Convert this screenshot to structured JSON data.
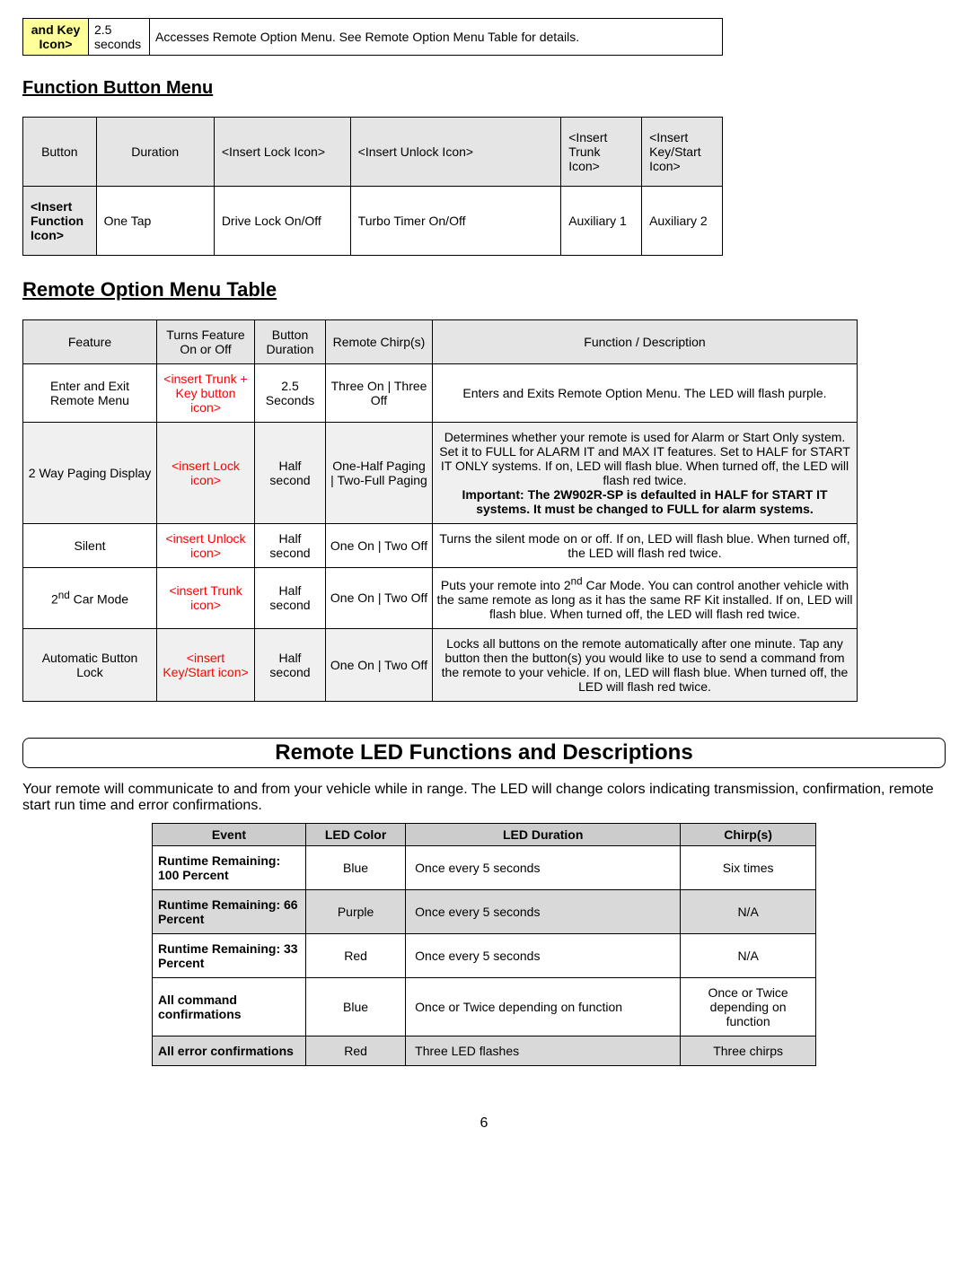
{
  "top_row": {
    "icon_label": "and Key Icon>",
    "duration": "2.5 seconds",
    "desc": "Accesses Remote Option Menu. See Remote Option Menu Table for details."
  },
  "section1_title": "Function Button Menu",
  "fbm": {
    "headers": [
      "Button",
      "Duration",
      "<Insert Lock Icon>",
      "<Insert Unlock Icon>",
      "<Insert Trunk Icon>",
      "<Insert Key/Start Icon>"
    ],
    "row": [
      "<Insert Function Icon>",
      "One Tap",
      "Drive Lock On/Off",
      "Turbo Timer On/Off",
      "Auxiliary 1",
      "Auxiliary 2"
    ]
  },
  "section2_title": "Remote Option Menu Table",
  "rom": {
    "headers": [
      "Feature",
      "Turns Feature On or Off",
      "Button Duration",
      "Remote Chirp(s)",
      "Function / Description"
    ],
    "rows": [
      {
        "feature": "Enter and Exit Remote Menu",
        "icon": "<insert Trunk + Key button icon>",
        "duration": "2.5 Seconds",
        "chirps": "Three On | Three Off",
        "desc1": "Enters and Exits Remote Option Menu. The LED will flash purple.",
        "desc_bold": ""
      },
      {
        "feature": "2 Way Paging Display",
        "icon": "<insert Lock icon>",
        "duration": "Half second",
        "chirps": "One-Half Paging | Two-Full Paging",
        "desc1": "Determines whether your remote is used for Alarm or Start Only system. Set it to FULL for ALARM IT and MAX IT features. Set to HALF for START IT ONLY systems. If on, LED will flash blue. When turned off, the LED will flash red twice.",
        "desc_bold": "Important: The 2W902R-SP is defaulted in HALF for START IT systems. It must be changed to FULL for alarm systems."
      },
      {
        "feature": "Silent",
        "icon": "<insert Unlock icon>",
        "duration": "Half second",
        "chirps": "One On | Two Off",
        "desc1": "Turns the silent mode on or off. If on, LED will flash blue. When turned off, the LED will flash red twice.",
        "desc_bold": ""
      },
      {
        "feature_html": "2<sup>nd</sup> Car Mode",
        "feature": "2nd Car Mode",
        "icon": "<insert Trunk icon>",
        "duration": "Half second",
        "chirps": "One On | Two Off",
        "desc1_html": "Puts your remote into 2<sup>nd</sup> Car Mode. You can control another vehicle with the same remote as long as it has the same RF Kit installed. If on, LED will flash blue. When turned off, the LED will flash red twice.",
        "desc1": "Puts your remote into 2nd Car Mode. You can control another vehicle with the same remote as long as it has the same RF Kit installed. If on, LED will flash blue. When turned off, the LED will flash red twice.",
        "desc_bold": ""
      },
      {
        "feature": "Automatic Button Lock",
        "icon": "<insert Key/Start icon>",
        "duration": "Half second",
        "chirps": "One On | Two Off",
        "desc1": "Locks all buttons on the remote automatically after one minute. Tap any button then the button(s) you would like to use to send a command from the remote to your vehicle. If on, LED will flash blue. When turned off, the LED will flash red twice.",
        "desc_bold": ""
      }
    ]
  },
  "banner": "Remote LED Functions and Descriptions",
  "intro": "Your remote will communicate to and from your vehicle while in range. The LED will change colors indicating transmission, confirmation, remote start run time and error confirmations.",
  "led": {
    "headers": [
      "Event",
      "LED Color",
      "LED Duration",
      "Chirp(s)"
    ],
    "rows": [
      {
        "event": "Runtime Remaining: 100 Percent",
        "color": "Blue",
        "duration": "Once every 5 seconds",
        "chirps": "Six times",
        "shade": false
      },
      {
        "event": "Runtime Remaining: 66 Percent",
        "color": "Purple",
        "duration": "Once every 5 seconds",
        "chirps": "N/A",
        "shade": true
      },
      {
        "event": "Runtime Remaining: 33 Percent",
        "color": "Red",
        "duration": "Once every 5 seconds",
        "chirps": "N/A",
        "shade": false
      },
      {
        "event": "All command confirmations",
        "color": "Blue",
        "duration": "Once or Twice depending on function",
        "chirps": "Once or Twice depending on function",
        "shade": false
      },
      {
        "event": "All error confirmations",
        "color": "Red",
        "duration": "Three LED flashes",
        "chirps": "Three chirps",
        "shade": true
      }
    ]
  },
  "page_num": "6"
}
